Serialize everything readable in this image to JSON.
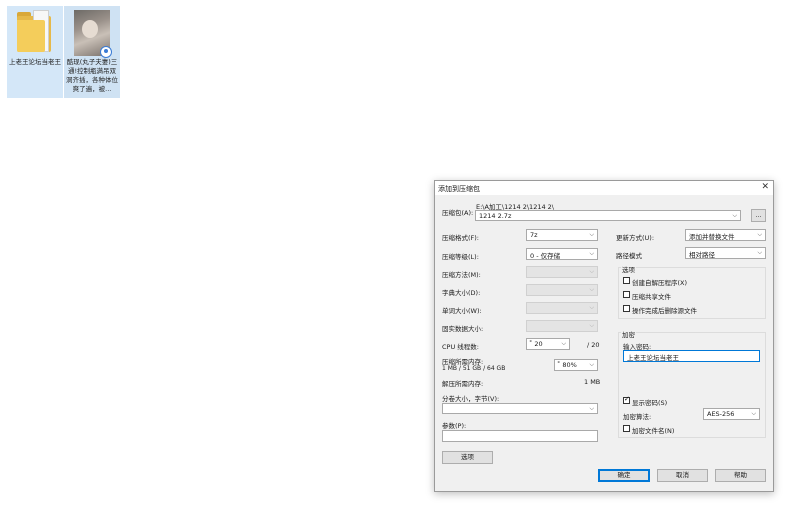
{
  "desktop": {
    "icons": [
      {
        "label": "上老王论坛当老王",
        "icon": "folder-icon"
      },
      {
        "label": "酷现(丸子夫妻)三通!控制瓶满吊双洞齐插，各种体位爽了遍，被...",
        "icon": "video-thumbnail-icon"
      }
    ]
  },
  "dialog": {
    "title": "添加到压缩包",
    "close": "✕",
    "archive": {
      "label": "压缩包(A):",
      "path": "E:\\A加工\\1214 2\\1214 2\\",
      "value": "1214 2.7z",
      "browse": "..."
    },
    "left": {
      "format_label": "压缩格式(F):",
      "format_value": "7z",
      "level_label": "压缩等级(L):",
      "level_value": "0 - 仅存储",
      "method_label": "压缩方法(M):",
      "dict_label": "字典大小(D):",
      "word_label": "单词大小(W):",
      "solid_label": "固实数据大小:",
      "cpu_label": "CPU 线程数:",
      "cpu_value": "20",
      "cpu_total": "/ 20",
      "mem_label": "压缩所需内存:",
      "mem_sub": "1 MB / 51 GB / 64 GB",
      "mem_value": "80%",
      "demem_label": "解压所需内存:",
      "demem_value": "1 MB",
      "split_label": "分卷大小，字节(V):",
      "params_label": "参数(P):",
      "options_button": "选项"
    },
    "right": {
      "update_label": "更新方式(U):",
      "update_value": "添加并替换文件",
      "path_label": "路径模式",
      "path_value": "相对路径",
      "options_title": "选项",
      "opt_sfx": "创建自解压程序(X)",
      "opt_shared": "压缩共享文件",
      "opt_delete": "操作完成后删除源文件",
      "enc_title": "加密",
      "pwd_label": "输入密码:",
      "pwd_value": "上老王论坛当老王",
      "show_pwd": "显示密码(S)",
      "enc_method_label": "加密算法:",
      "enc_method_value": "AES-256",
      "enc_names": "加密文件名(N)"
    },
    "buttons": {
      "ok": "确定",
      "cancel": "取消",
      "help": "帮助"
    }
  }
}
